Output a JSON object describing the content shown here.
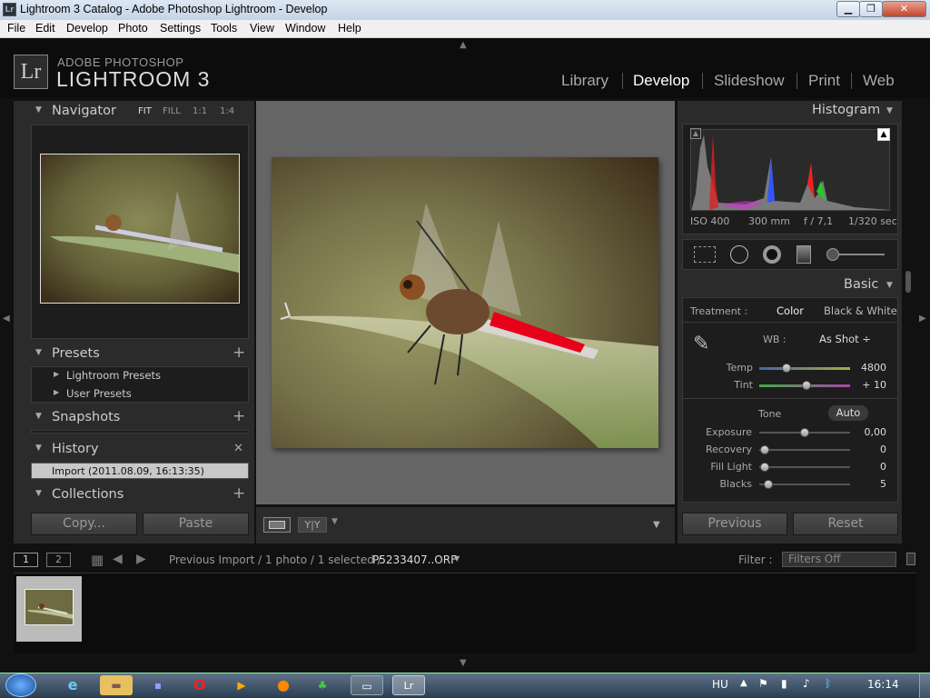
{
  "window": {
    "title": "Lightroom 3 Catalog - Adobe Photoshop Lightroom - Develop",
    "min": "▁",
    "max": "❐",
    "close": "✕"
  },
  "menus": [
    "File",
    "Edit",
    "Develop",
    "Photo",
    "Settings",
    "Tools",
    "View",
    "Window",
    "Help"
  ],
  "brand": {
    "logo": "Lr",
    "line1": "ADOBE PHOTOSHOP",
    "line2": "LIGHTROOM 3"
  },
  "modules": [
    "Library",
    "Develop",
    "Slideshow",
    "Print",
    "Web"
  ],
  "navigator": {
    "title": "Navigator",
    "zoom": [
      "FIT",
      "FILL",
      "1:1",
      "1:4"
    ]
  },
  "presets": {
    "title": "Presets",
    "items": [
      "Lightroom Presets",
      "User Presets"
    ]
  },
  "snapshots": {
    "title": "Snapshots"
  },
  "history": {
    "title": "History",
    "items": [
      "Import (2011.08.09, 16:13:35)"
    ]
  },
  "collections": {
    "title": "Collections"
  },
  "left_buttons": {
    "copy": "Copy...",
    "paste": "Paste"
  },
  "histogram": {
    "title": "Histogram",
    "iso": "ISO 400",
    "focal": "300 mm",
    "aperture": "f / 7,1",
    "shutter": "1/320 sec"
  },
  "basic": {
    "title": "Basic",
    "treatment_label": "Treatment :",
    "color": "Color",
    "bw": "Black & White",
    "wb_label": "WB :",
    "wb_value": "As Shot ÷",
    "sliders": [
      {
        "label": "Temp",
        "value": "4800",
        "pos": 0.4
      },
      {
        "label": "Tint",
        "value": "+ 10",
        "pos": 0.52
      }
    ],
    "tone_label": "Tone",
    "auto": "Auto",
    "tone_sliders": [
      {
        "label": "Exposure",
        "value": "0,00",
        "pos": 0.5
      },
      {
        "label": "Recovery",
        "value": "0",
        "pos": 0.0
      },
      {
        "label": "Fill Light",
        "value": "0",
        "pos": 0.0
      },
      {
        "label": "Blacks",
        "value": "5",
        "pos": 0.05
      }
    ]
  },
  "right_buttons": {
    "previous": "Previous",
    "reset": "Reset"
  },
  "filmstrip": {
    "screen1": "1",
    "screen2": "2",
    "path": "Previous Import / 1 photo / 1 selected /",
    "filename": "P5233407..ORF",
    "filter_label": "Filter :",
    "filter_value": "Filters Off"
  },
  "taskbar": {
    "lang": "HU",
    "time": "16:14"
  }
}
